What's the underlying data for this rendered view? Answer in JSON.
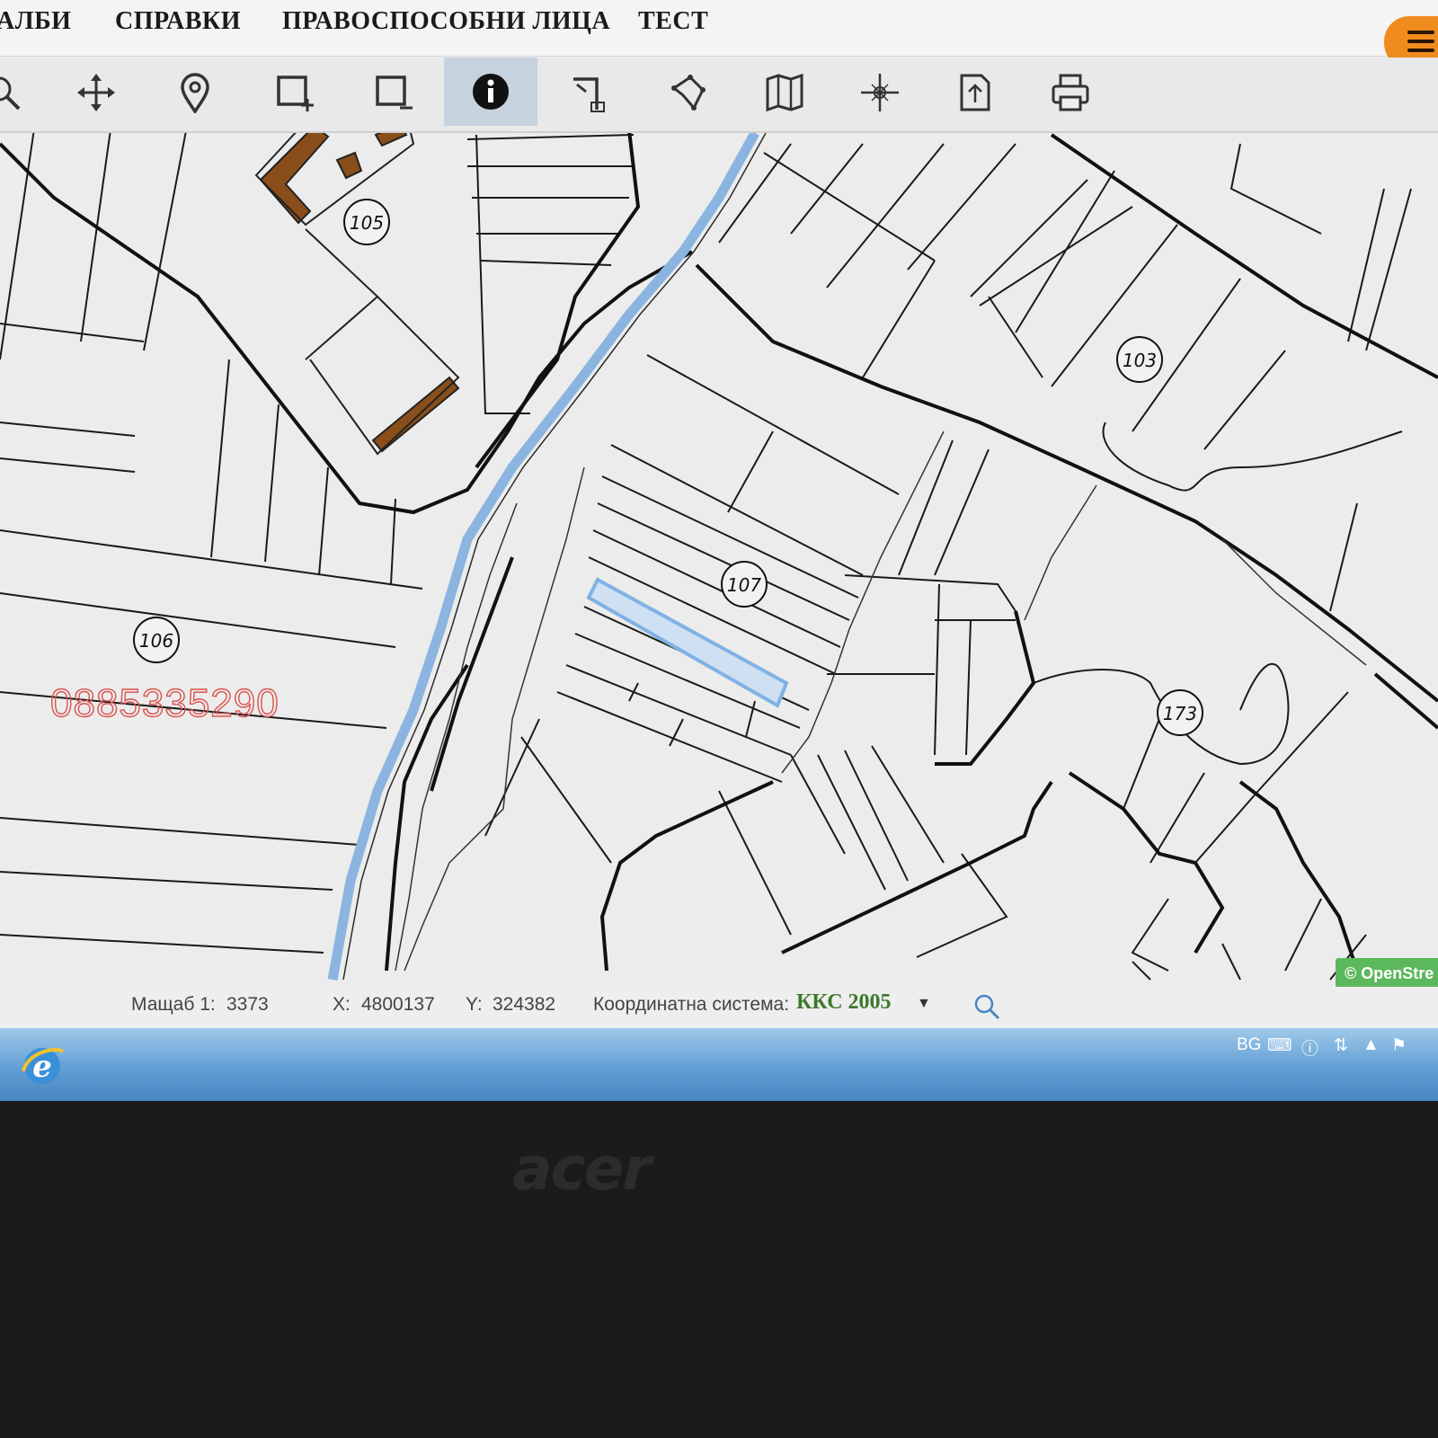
{
  "nav": {
    "items": [
      "АЛБИ",
      "СПРАВКИ",
      "ПРАВОСПОСОБНИ ЛИЦА",
      "ТЕСТ"
    ]
  },
  "toolbar": {
    "tools": [
      "zoom-icon",
      "pan-icon",
      "location-pin-icon",
      "rectangle-add-icon",
      "rectangle-remove-icon",
      "info-icon",
      "corner-select-icon",
      "polygon-icon",
      "map-book-icon",
      "crosshair-icon",
      "export-icon",
      "print-icon"
    ],
    "active_tool": "info-icon"
  },
  "map": {
    "parcel_labels": [
      "105",
      "103",
      "107",
      "106",
      "173"
    ],
    "watermark": "0885335290",
    "attribution": "© OpenStre",
    "highlight_color": "#7fb2e5",
    "river_color": "#8bb5e0",
    "building_color": "#8a4e1a"
  },
  "status": {
    "scale_label": "Мащаб 1:",
    "scale_value": "3373",
    "x_label": "X:",
    "x_value": "4800137",
    "y_label": "Y:",
    "y_value": "324382",
    "crs_label": "Координатна система:",
    "crs_value": "ККС 2005"
  },
  "taskbar": {
    "lang": "BG"
  },
  "laptop": {
    "brand": "acer"
  },
  "colors": {
    "accent": "#f08c1e",
    "active_tool_bg": "#c6d2de"
  }
}
